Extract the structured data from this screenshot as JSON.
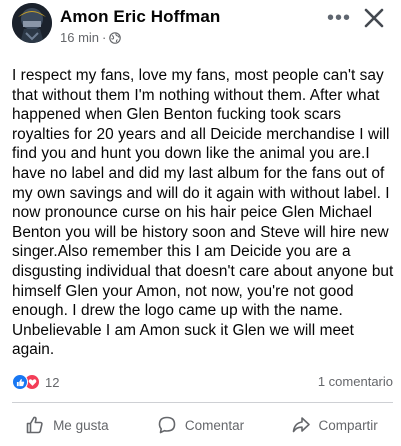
{
  "post": {
    "author": "Amon Eric Hoffman",
    "time": "16 min",
    "separator": "·",
    "privacy_icon": "globe-icon",
    "more_label": "•••",
    "body": "I respect my fans, love my fans, most people can't say that without them I'm nothing without them. After what happened when Glen Benton fucking took scars royalties for 20 years and all Deicide merchandise I will find you and hunt you down like the animal you are.I have no label and did my last album for the fans out of my own savings and will do it again with without label. I now pronounce curse on his hair peice Glen Michael Benton you will be history soon and Steve will hire new singer.Also remember this I am Deicide you are a disgusting individual that doesn't care about anyone but himself Glen your Amon, not now, you're not good enough. I drew the logo came up with the name. Unbelievable I am Amon suck it Glen we will meet again."
  },
  "engagement": {
    "reaction_count": "12",
    "comment_count": "1 comentario"
  },
  "actions": {
    "like_label": "Me gusta",
    "comment_label": "Comentar",
    "share_label": "Compartir"
  },
  "colors": {
    "like_blue": "#1877f2",
    "love_red": "#f33e58",
    "secondary_text": "#65676b",
    "primary_text": "#050505",
    "divider": "#ced0d4"
  }
}
